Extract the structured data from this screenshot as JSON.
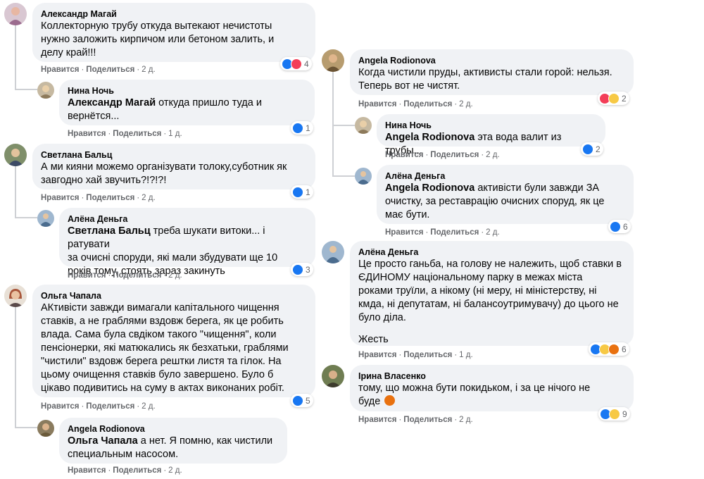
{
  "actions": {
    "like": "Нравится",
    "share": "Поделиться"
  },
  "comments": {
    "c1": {
      "author": "Александр Магай",
      "text": "Коллекторную трубу откуда вытекают нечистоты\nнужно заложить кирпичом или бетоном залить, и\nделу край!!!",
      "time": "2 д.",
      "reactions": [
        "like",
        "love"
      ],
      "count": "4"
    },
    "c2": {
      "author": "Нина Ночь",
      "mention": "Александр Магай",
      "text": " откуда пришло туда и\nвернётся...",
      "time": "1 д.",
      "reactions": [
        "like"
      ],
      "count": "1"
    },
    "c3": {
      "author": "Светлана Бальц",
      "text": "А ми кияни можемо організувати толоку,суботник як\nзавгодно хай звучить?!?!?!",
      "time": "2 д.",
      "reactions": [
        "like"
      ],
      "count": "1"
    },
    "c4": {
      "author": "Алёна Деньга",
      "mention": "Светлана Бальц",
      "text": " треба шукати витоки... і ратувати\nза очисні споруди, які мали збудувати ще 10\nроків тому, стоять зараз закинуть",
      "time": "2 д.",
      "reactions": [
        "like"
      ],
      "count": "3"
    },
    "c5": {
      "author": "Ольга Чапала",
      "text": "АКтивісти завжди вимагали капітального чищення\nставків, а не граблями вздовж берега, як це робить\nвлада. Сама була свдіком такого \"чищення\", коли\nпенсіонерки, які матюкались як безхатьки, граблями\n\"чистили\" вздовж берега рештки листя та гілок. На\nцьому очищення ставків було завершено. Було б\nцікаво подивитись на суму в актах виконаних робіт.",
      "time": "2 д.",
      "reactions": [
        "like"
      ],
      "count": "5"
    },
    "c6": {
      "author": "Angela Rodionova",
      "mention": "Ольга Чапала",
      "text": " а нет. Я помню, как чистили\nспециальным насосом.",
      "time": "2 д."
    },
    "c7": {
      "author": "Angela Rodionova",
      "text": "Когда чистили пруды, активисты стали горой: нельзя.\nТеперь вот не чистят.",
      "time": "2 д.",
      "reactions": [
        "love",
        "haha"
      ],
      "count": "2"
    },
    "c8": {
      "author": "Нина Ночь",
      "mention": "Angela Rodionova",
      "text": " эта вода валит из трубы...",
      "time": "2 д.",
      "reactions": [
        "like"
      ],
      "count": "2"
    },
    "c9": {
      "author": "Алёна Деньга",
      "mention": "Angela Rodionova",
      "text": " активісти були завжди ЗА\nочистку, за реставрацію очисних споруд, як це\nмає бути.",
      "time": "2 д.",
      "reactions": [
        "like"
      ],
      "count": "6"
    },
    "c10": {
      "author": "Алёна Деньга",
      "text": "Це просто ганьба, на голову не належить, щоб ставки в\nЄДИНОМУ національному парку в межах міста\nроками труїли, а нікому (ні меру, ні міністерству, ні\nкмда, ні депутатам, ні балансоутримувачу) до цього не\nбуло діла.",
      "text2": "Жесть",
      "time": "1 д.",
      "reactions": [
        "like",
        "sad",
        "angry"
      ],
      "count": "6"
    },
    "c11": {
      "author": "Ірина Власенко",
      "text": "тому, що можна бути покидьком, і за це нічого не\nбуде",
      "time": "2 д.",
      "reactions": [
        "like",
        "sad"
      ],
      "count": "9"
    }
  },
  "colors": {
    "bubble": "#f0f2f5",
    "like": "#1877f2",
    "love": "#f33e58",
    "angry": "#e9710f",
    "meta": "#65676b"
  }
}
